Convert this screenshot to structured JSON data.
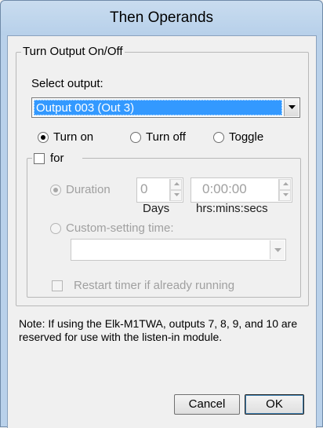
{
  "dialog": {
    "title": "Then Operands"
  },
  "group": {
    "legend": "Turn Output On/Off",
    "select_output_label": "Select output:",
    "selected_output": "Output 003 (Out 3)",
    "actions": [
      {
        "label": "Turn on",
        "checked": true
      },
      {
        "label": "Turn off",
        "checked": false
      },
      {
        "label": "Toggle",
        "checked": false
      }
    ]
  },
  "for_group": {
    "checkbox_label": "for",
    "checked": false,
    "duration_label": "Duration",
    "duration_days_value": "0",
    "duration_time_value": "0:00:00",
    "days_caption": "Days",
    "time_caption": "hrs:mins:secs",
    "custom_label": "Custom-setting time:",
    "custom_value": "",
    "restart_label": "Restart timer if already running"
  },
  "note": "Note: If using the Elk-M1TWA, outputs 7, 8, 9, and 10 are reserved for use with the listen-in module.",
  "buttons": {
    "cancel": "Cancel",
    "ok": "OK"
  }
}
